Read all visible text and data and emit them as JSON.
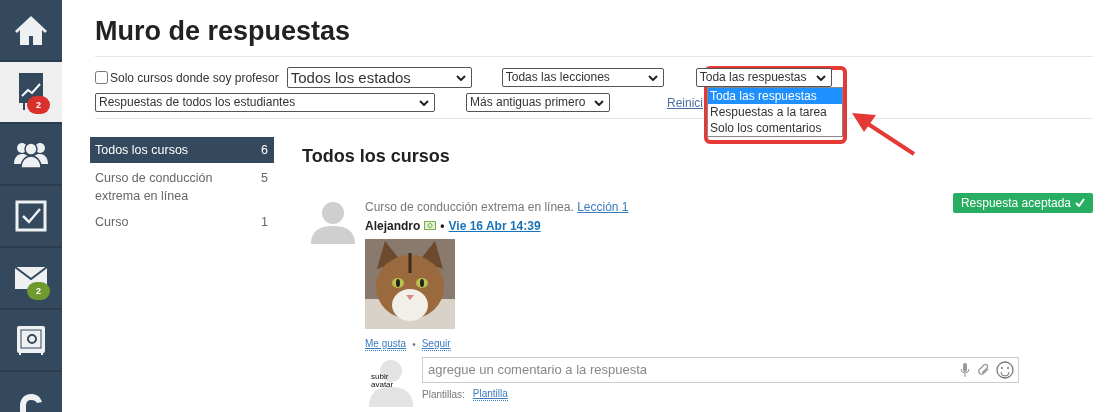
{
  "sidebar": {
    "items": [
      {
        "kind": "home",
        "selected": false
      },
      {
        "kind": "chart",
        "selected": true,
        "badge": "2",
        "color": "#d9302c"
      },
      {
        "kind": "people",
        "selected": false
      },
      {
        "kind": "check",
        "selected": false
      },
      {
        "kind": "mail",
        "selected": false,
        "badge": "2",
        "color": "#6e9a2f"
      },
      {
        "kind": "safe",
        "selected": false
      },
      {
        "kind": "letter",
        "selected": false
      }
    ]
  },
  "title": "Muro de respuestas",
  "filters": {
    "teacher_only": {
      "label": "Solo cursos donde soy profesor",
      "checked": false
    },
    "status": "Todos los estados",
    "lessons": "Todas las lecciones",
    "answers": {
      "value": "Toda las respuestas",
      "expanded": true,
      "options": [
        {
          "label": "Toda las respuestas",
          "selected": true
        },
        {
          "label": "Respuestas a la tarea",
          "selected": false
        },
        {
          "label": "Solo los comentarios",
          "selected": false
        }
      ]
    },
    "students": "Respuestas de todos los estudiantes",
    "order": "Más antiguas primero",
    "reset": "Reinici"
  },
  "course_list": [
    {
      "label": "Todos los cursos",
      "count": "6",
      "selected": true
    },
    {
      "label": "Curso de conducción extrema en línea",
      "count": "5",
      "selected": false
    },
    {
      "label": "Curso",
      "count": "1",
      "selected": false
    }
  ],
  "feed": {
    "heading": "Todos los cursos",
    "post": {
      "course": "Curso de conducción extrema en línea.",
      "lesson": "Lección 1",
      "author": "Alejandro",
      "date_separator": "•",
      "date": "Vie 16 Abr 14:39",
      "status": "Respuesta aceptada",
      "actions": [
        "Me gusta",
        "Seguir"
      ],
      "action_separator": "•",
      "avatar_label": "subir avatar",
      "comment_placeholder": "agregue un comentario a la respuesta",
      "templates_label": "Plantillas:",
      "template": "Plantilla"
    }
  }
}
